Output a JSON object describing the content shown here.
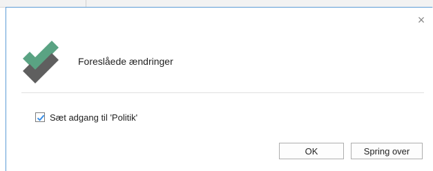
{
  "dialog": {
    "title": "Foreslåede ændringer",
    "close_symbol": "×",
    "logo_icon": "double-checkmark-icon",
    "colors": {
      "accent_green": "#5aa383",
      "accent_gray": "#5f5f5f",
      "border_blue": "#5b9bd5",
      "checkbox_blue": "#3a8ee6"
    }
  },
  "options": {
    "grant_access": {
      "label": "Sæt adgang til 'Politik'",
      "checked": true
    }
  },
  "buttons": {
    "ok_label": "OK",
    "skip_label": "Spring over"
  }
}
